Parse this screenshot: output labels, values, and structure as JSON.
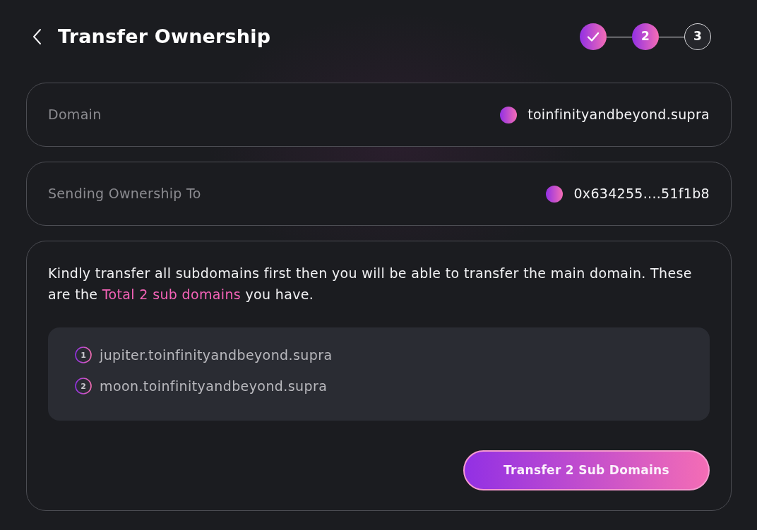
{
  "header": {
    "title": "Transfer Ownership"
  },
  "steps": [
    {
      "completed": true,
      "active": false
    },
    {
      "label": "2",
      "completed": false,
      "active": true
    },
    {
      "label": "3",
      "completed": false,
      "active": false
    }
  ],
  "fields": [
    {
      "label": "Domain",
      "value": "toinfinityandbeyond.supra"
    },
    {
      "label": "Sending Ownership To",
      "value": "0x634255....51f1b8"
    }
  ],
  "notice": [
    {
      "text": "Kindly transfer all subdomains first then you will be able to transfer the main domain. These are the ",
      "highlight": false
    },
    {
      "text": "Total 2 sub domains",
      "highlight": true
    },
    {
      "text": " you have.",
      "highlight": false
    }
  ],
  "subdomains": [
    {
      "number": "1",
      "name": "jupiter.toinfinityandbeyond.supra"
    },
    {
      "number": "2",
      "name": "moon.toinfinityandbeyond.supra"
    }
  ],
  "action": {
    "label": "Transfer 2 Sub Domains"
  }
}
